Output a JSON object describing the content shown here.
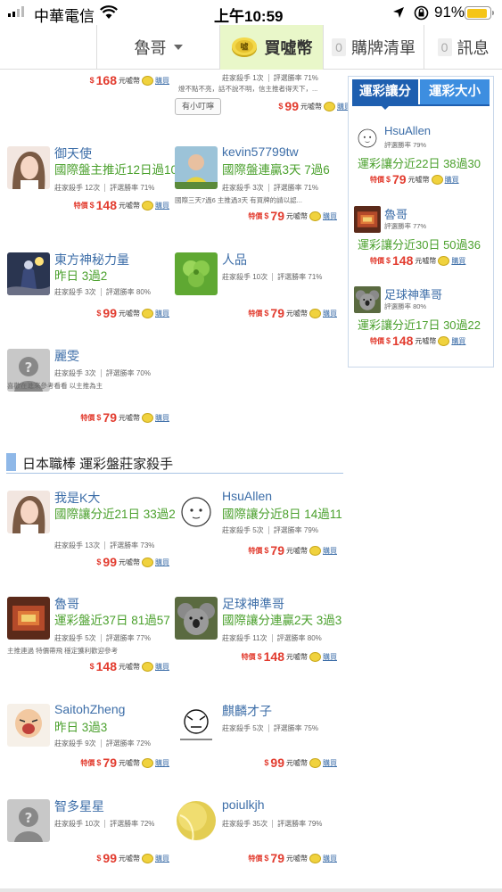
{
  "status_bar": {
    "carrier": "中華電信",
    "time": "上午10:59",
    "battery": "91%"
  },
  "nav": {
    "user": "魯哥",
    "buy": "買噓幣",
    "coin_label": "噓",
    "cart_count": "0",
    "cart": "購牌清單",
    "msg_count": "0",
    "msg": "訊息"
  },
  "labels": {
    "sp": "特價",
    "dollar": "$",
    "unit": "元噓幣",
    "buy": "購買",
    "killer": "莊家殺手",
    "winrate": "評選勝率"
  },
  "top_partial": {
    "left_price": "168",
    "right_meta": [
      "莊家殺手 1次",
      "評選勝率 71%"
    ],
    "right_note": "燈不點不亮，話不說不明，信主推者得天下，...",
    "right_price": "99",
    "tip_button": "有小叮嚀"
  },
  "cards": [
    {
      "name": "御天使",
      "record": "國際盤主推近12日過10",
      "kills": "12次",
      "rate": "71%",
      "special": true,
      "price": "148"
    },
    {
      "name": "kevin57799tw",
      "record": "國際盤連贏3天 7過6",
      "kills": "3次",
      "rate": "71%",
      "note": "國際三天7過6 主推過3天 有買牌的請以認...",
      "special": true,
      "price": "79"
    },
    {
      "name": "東方神秘力量",
      "record": "昨日 3過2",
      "kills": "3次",
      "rate": "80%",
      "special": false,
      "price": "99"
    },
    {
      "name": "人品",
      "record": "",
      "kills": "10次",
      "rate": "71%",
      "special": true,
      "price": "79"
    },
    {
      "name": "麗雯",
      "record": "",
      "kills": "3次",
      "rate": "70%",
      "note": "喜歡在進來參考看看 以主推為主",
      "special": true,
      "price": "79"
    }
  ],
  "section2": {
    "title": "日本職棒  運彩盤莊家殺手",
    "cards": [
      {
        "name": "我是K大",
        "record": "國際讓分近21日 33過24",
        "kills": "13次",
        "rate": "73%",
        "special": false,
        "price": "99"
      },
      {
        "name": "HsuAllen",
        "record": "國際讓分近8日 14過11",
        "kills": "5次",
        "rate": "79%",
        "special": true,
        "price": "79"
      },
      {
        "name": "魯哥",
        "record": "運彩盤近37日 81過57",
        "kills": "5次",
        "rate": "77%",
        "note": "主推連過 特價帶飛 穩定獲利歡迎參考",
        "special": false,
        "price": "148"
      },
      {
        "name": "足球神準哥",
        "record": "國際讓分連贏2天 3過3",
        "kills": "11次",
        "rate": "80%",
        "special": true,
        "price": "148"
      },
      {
        "name": "SaitohZheng",
        "record": "昨日 3過3",
        "kills": "9次",
        "rate": "72%",
        "special": true,
        "price": "79"
      },
      {
        "name": "麒麟才子",
        "record": "",
        "kills": "5次",
        "rate": "75%",
        "special": false,
        "price": "99"
      },
      {
        "name": "智多星星",
        "record": "",
        "kills": "10次",
        "rate": "72%",
        "special": false,
        "price": "99"
      },
      {
        "name": "poiulkjh",
        "record": "",
        "kills": "35次",
        "rate": "79%",
        "special": true,
        "price": "79"
      }
    ]
  },
  "right_panel": {
    "tab_active": "運彩讓分",
    "tab_other": "運彩大小",
    "items": [
      {
        "name": "HsuAllen",
        "rate": "評選勝率 79%",
        "record": "運彩讓分近22日 38過30",
        "price": "79"
      },
      {
        "name": "魯哥",
        "rate": "評選勝率 77%",
        "record": "運彩讓分近30日 50過36",
        "price": "148"
      },
      {
        "name": "足球神準哥",
        "rate": "評選勝率 80%",
        "record": "運彩讓分近17日 30過22",
        "price": "148"
      }
    ]
  }
}
